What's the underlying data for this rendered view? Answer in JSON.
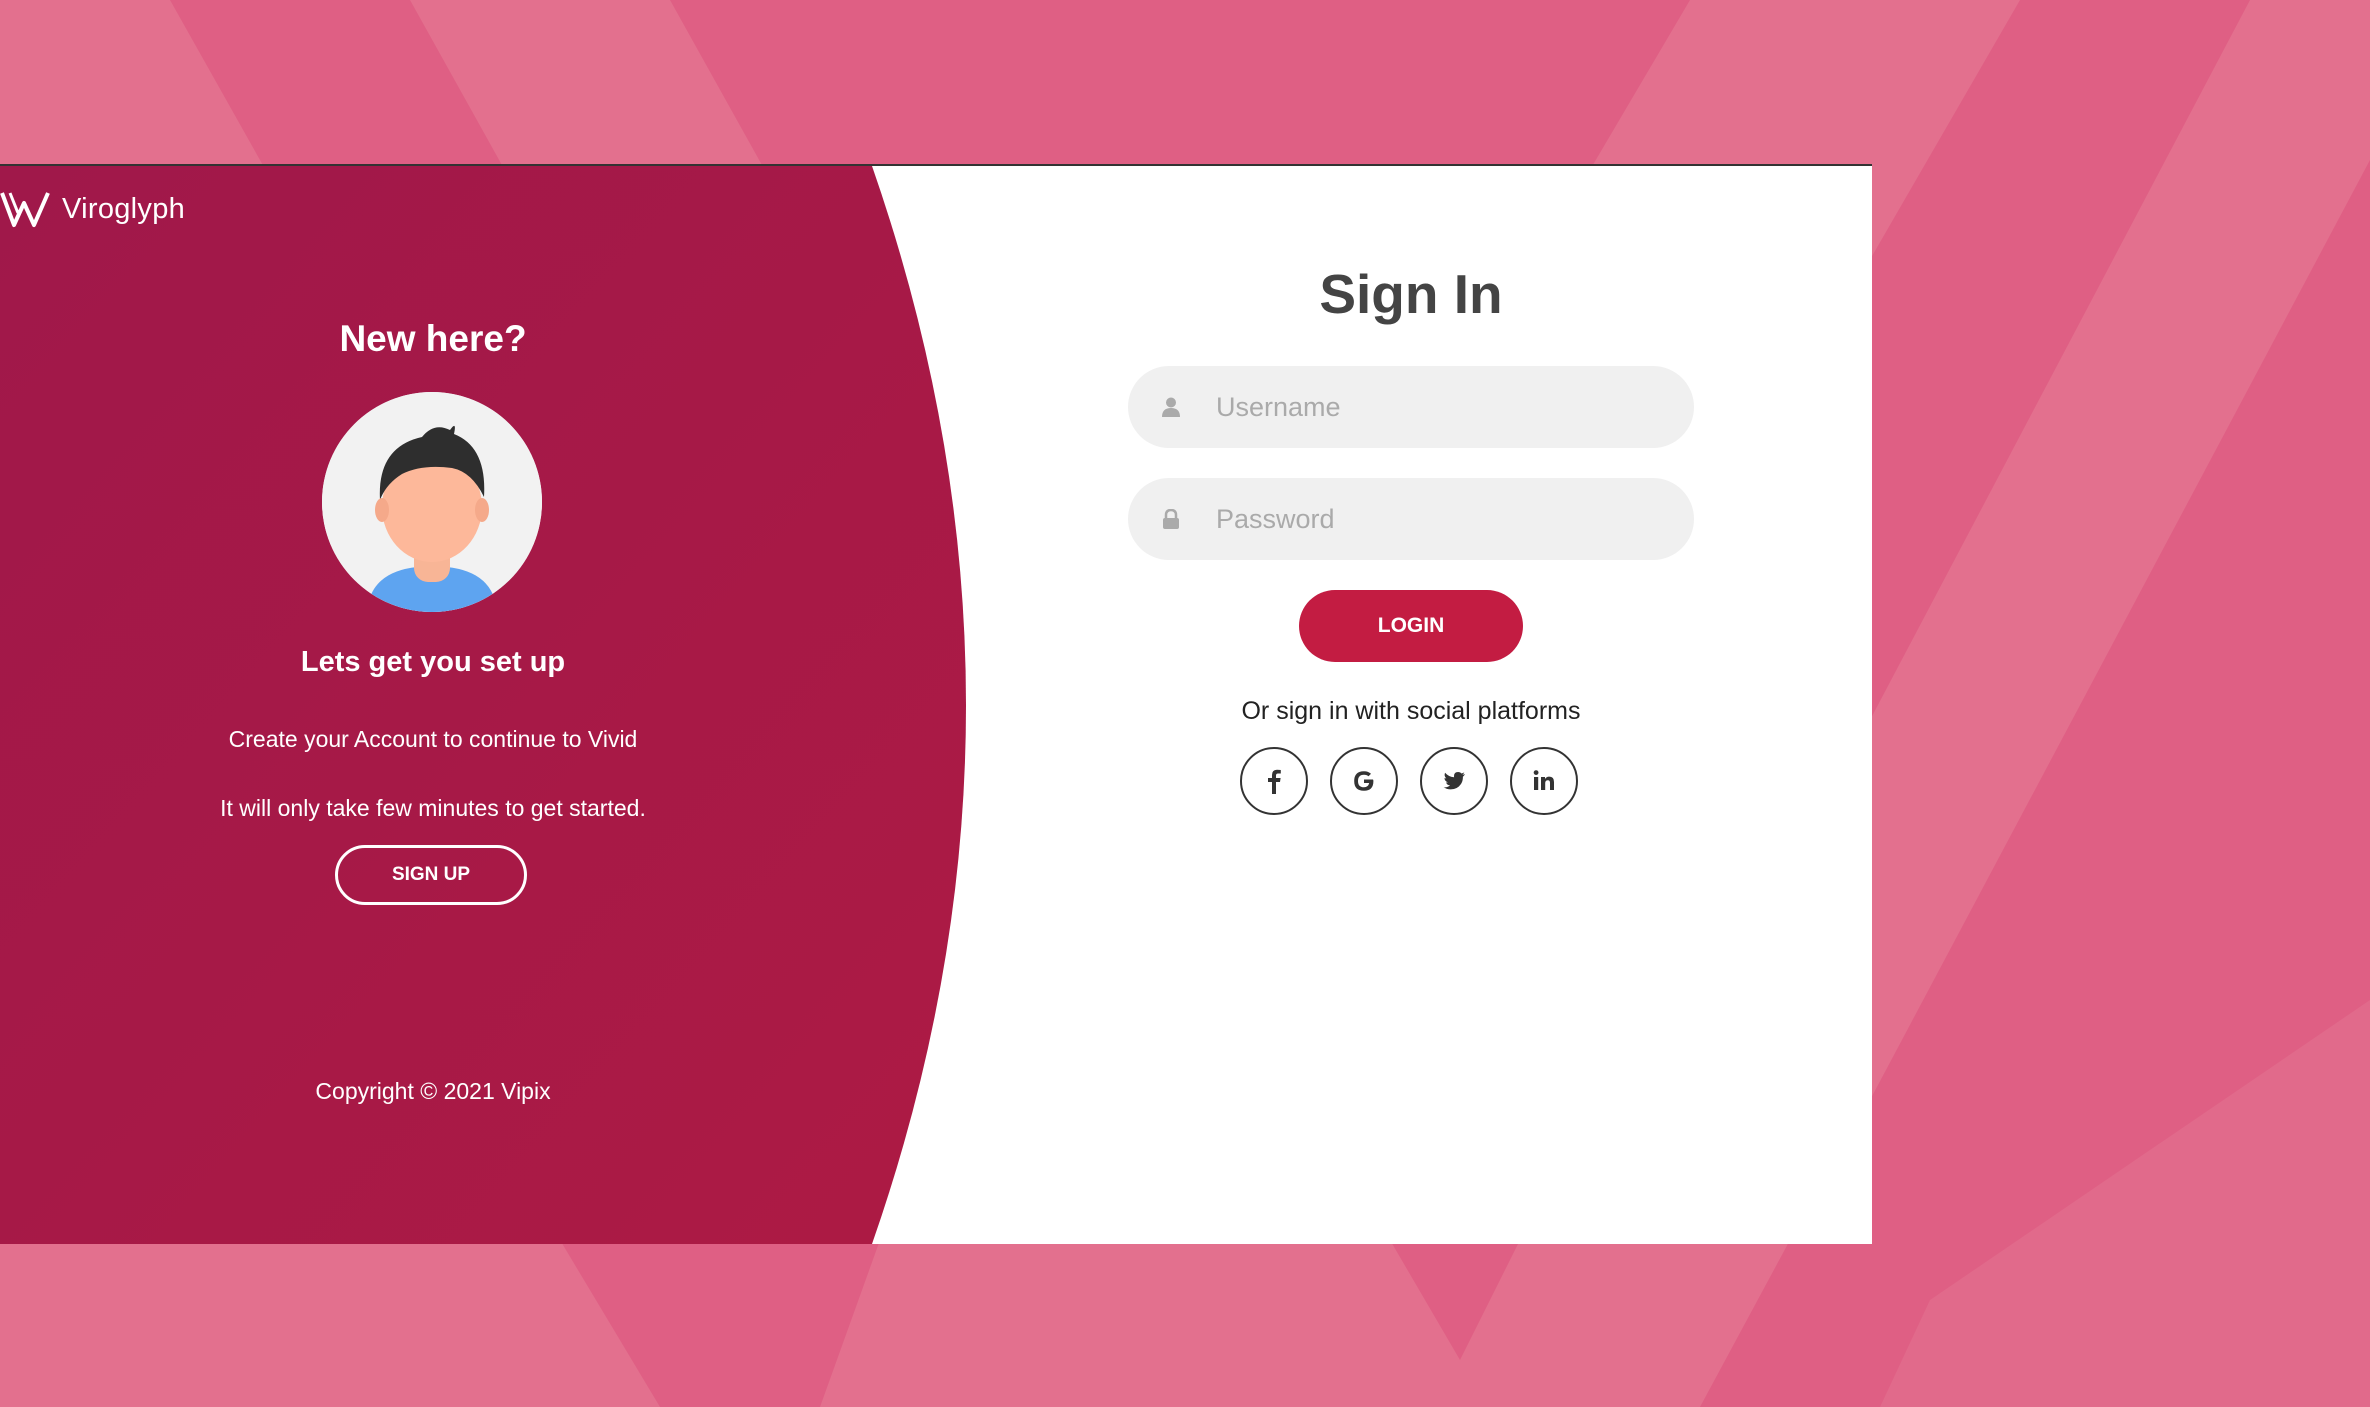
{
  "brand": {
    "name": "Viroglyph"
  },
  "left": {
    "heading": "New here?",
    "subheading": "Lets get you set up",
    "line1": "Create your Account to continue to Vivid",
    "line2": "It will only take few minutes to get started.",
    "signup_label": "SIGN UP",
    "copyright": "Copyright © 2021 Vipix"
  },
  "form": {
    "title": "Sign In",
    "username_placeholder": "Username",
    "password_placeholder": "Password",
    "login_label": "LOGIN",
    "social_text": "Or sign in with social platforms",
    "socials": [
      "facebook-icon",
      "google-icon",
      "twitter-icon",
      "linkedin-icon"
    ]
  },
  "colors": {
    "background": "#df5f84",
    "panel": "#a3184a",
    "accent": "#c31c42"
  }
}
